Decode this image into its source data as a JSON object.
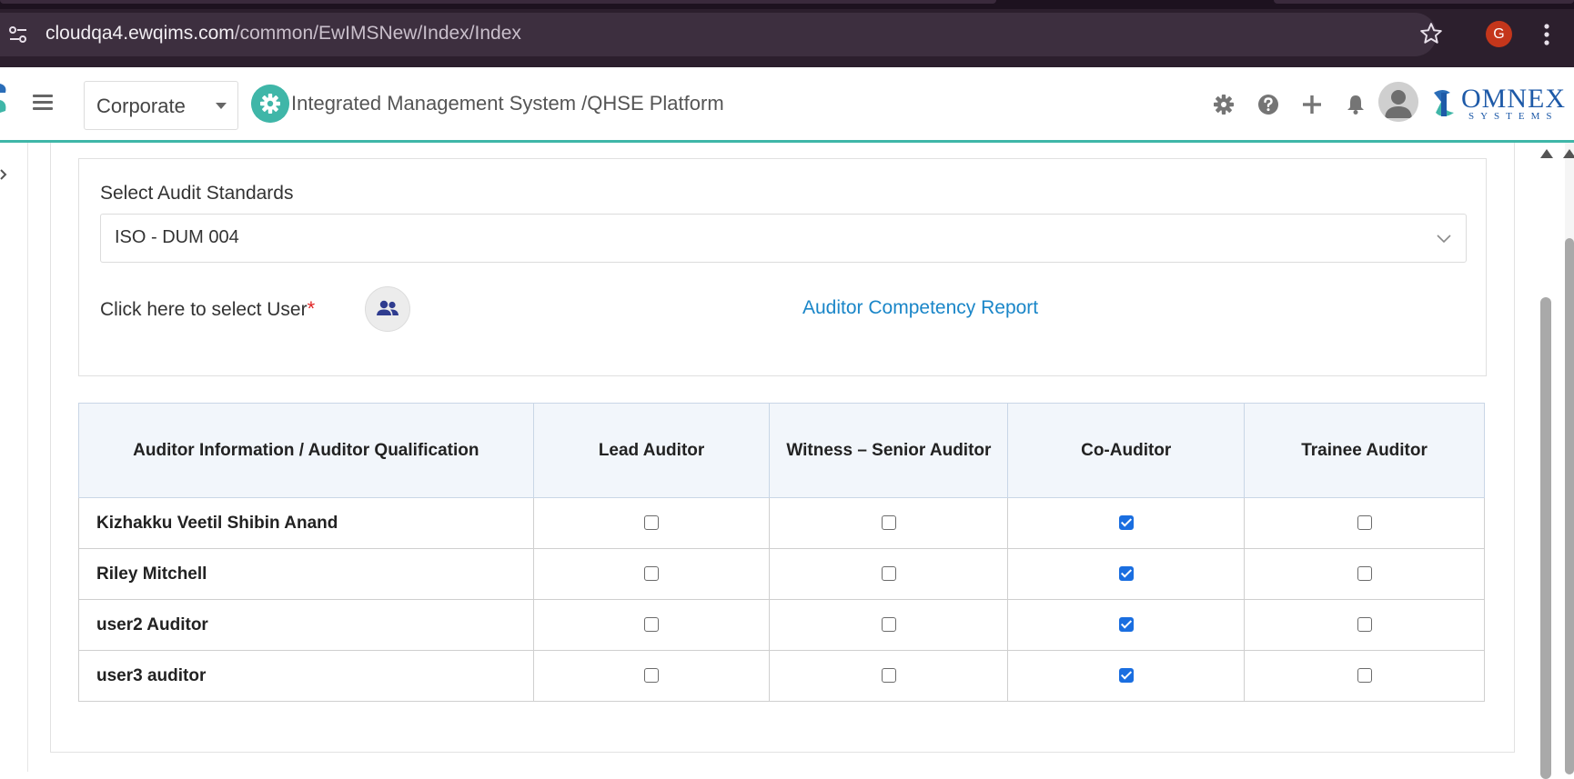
{
  "browser": {
    "url_host": "cloudqa4.ewqims.com",
    "url_path": "/common/EwIMSNew/Index/Index",
    "profile_initial": "G"
  },
  "header": {
    "org_select_value": "Corporate",
    "app_title": "Integrated Management System /QHSE Platform",
    "brand_name": "OMNEX",
    "brand_sub": "SYSTEMS",
    "icons": [
      "gear-icon",
      "help-icon",
      "plus-icon",
      "bell-icon"
    ],
    "accent_color": "#3fb6a8"
  },
  "form": {
    "standards_label": "Select Audit Standards",
    "standards_value": "ISO - DUM 004",
    "user_select_label": "Click here to select User",
    "required_mark": "*",
    "report_link": "Auditor Competency Report"
  },
  "table": {
    "headers": [
      "Auditor Information / Auditor Qualification",
      "Lead Auditor",
      "Witness – Senior Auditor",
      "Co-Auditor",
      "Trainee Auditor"
    ],
    "rows": [
      {
        "name": "Kizhakku Veetil Shibin Anand",
        "lead": false,
        "witness": false,
        "co": true,
        "trainee": false
      },
      {
        "name": "Riley Mitchell",
        "lead": false,
        "witness": false,
        "co": true,
        "trainee": false
      },
      {
        "name": "user2 Auditor",
        "lead": false,
        "witness": false,
        "co": true,
        "trainee": false
      },
      {
        "name": "user3 auditor",
        "lead": false,
        "witness": false,
        "co": true,
        "trainee": false
      }
    ]
  }
}
